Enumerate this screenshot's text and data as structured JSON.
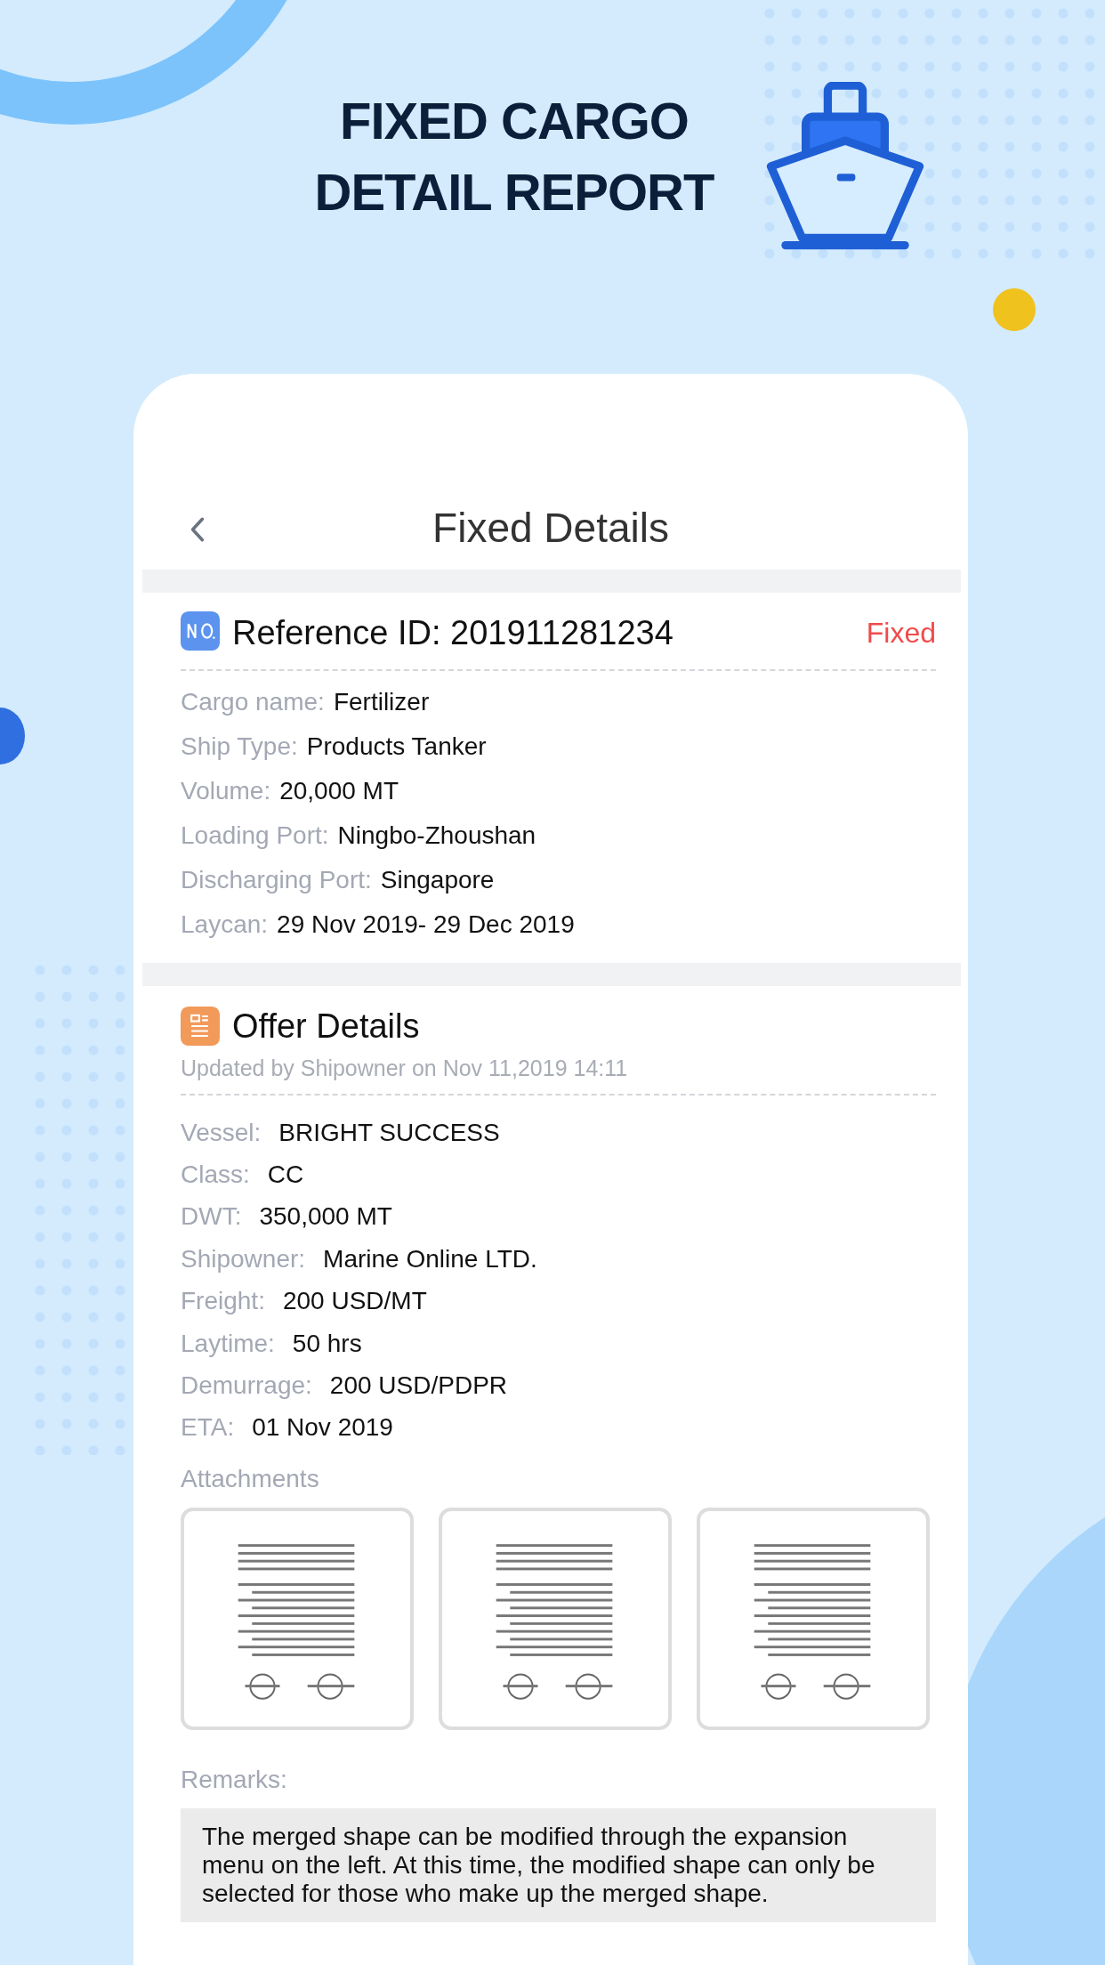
{
  "headline_lines": [
    "FIXED CARGO",
    "DETAIL REPORT"
  ],
  "screen": {
    "title": "Fixed Details",
    "reference": {
      "text": "Reference ID: 201911281234",
      "status": "Fixed"
    },
    "cargo_fields": [
      {
        "label": "Cargo name:",
        "value": "Fertilizer"
      },
      {
        "label": "Ship Type:",
        "value": "Products Tanker"
      },
      {
        "label": "Volume:",
        "value": "20,000 MT"
      },
      {
        "label": "Loading Port:",
        "value": "Ningbo-Zhoushan"
      },
      {
        "label": "Discharging Port:",
        "value": "Singapore"
      },
      {
        "label": "Laycan:",
        "value": "29 Nov 2019- 29 Dec 2019"
      }
    ],
    "offer": {
      "title": "Offer Details",
      "updated": "Updated by Shipowner on Nov 11,2019 14:11",
      "fields": [
        {
          "label": "Vessel:",
          "value": "BRIGHT SUCCESS"
        },
        {
          "label": "Class:",
          "value": "CC"
        },
        {
          "label": "DWT:",
          "value": "350,000 MT"
        },
        {
          "label": "Shipowner:",
          "value": "Marine Online LTD."
        },
        {
          "label": "Freight:",
          "value": "200 USD/MT"
        },
        {
          "label": "Laytime:",
          "value": "50 hrs"
        },
        {
          "label": "Demurrage:",
          "value": "200 USD/PDPR"
        },
        {
          "label": "ETA:",
          "value": "01 Nov 2019"
        }
      ]
    },
    "attachments": {
      "label": "Attachments",
      "items": [
        {
          "kind": "document"
        },
        {
          "kind": "document"
        },
        {
          "kind": "document"
        }
      ]
    },
    "remarks": {
      "label": "Remarks:",
      "text": "The merged shape can be modified through the expansion menu on the left. At this time, the modified shape can only be selected for those who make up the merged shape."
    }
  }
}
